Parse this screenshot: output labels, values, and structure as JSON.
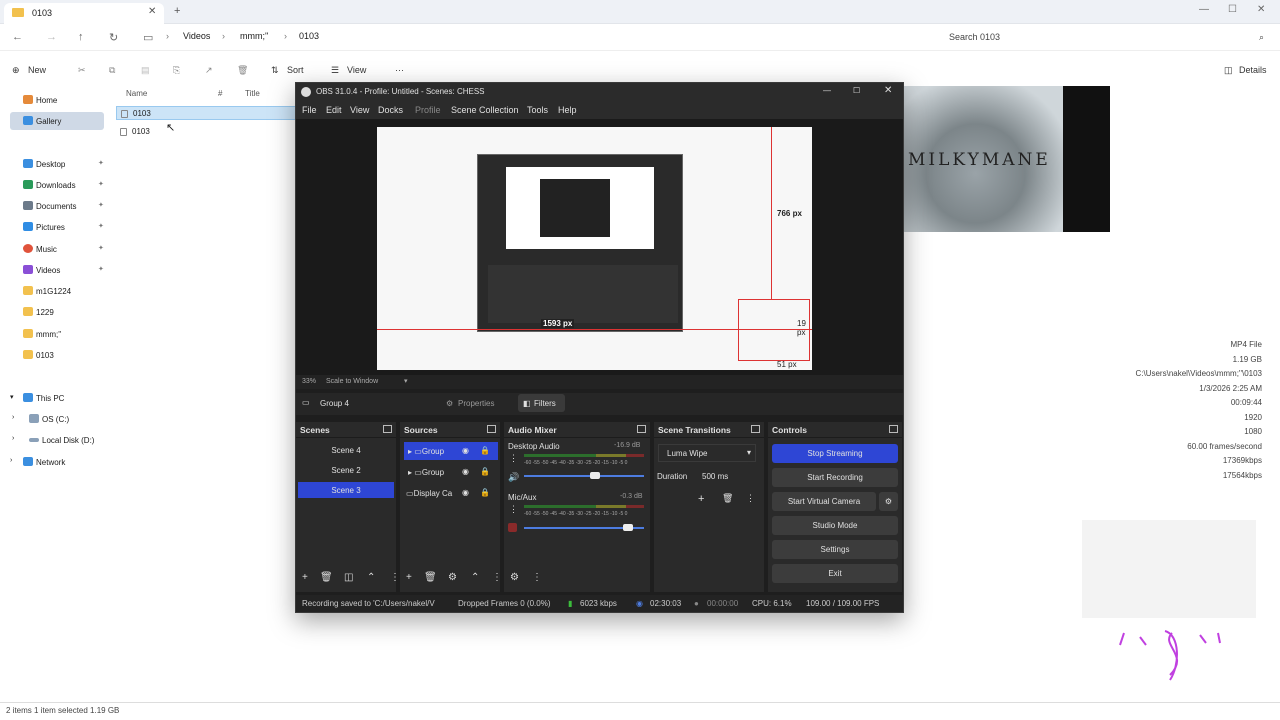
{
  "explorer": {
    "tab_title": "0103",
    "new_tab": "+",
    "breadcrumb": [
      "Videos",
      "mmm;''",
      "0103"
    ],
    "search_placeholder": "Search 0103",
    "toolbar": {
      "new": "New",
      "sort": "Sort",
      "view": "View",
      "more": "···",
      "details": "Details"
    },
    "nav_top": [
      "Home",
      "Gallery"
    ],
    "nav_pinned": [
      "Desktop",
      "Downloads",
      "Documents",
      "Pictures",
      "Music",
      "Videos"
    ],
    "nav_folders": [
      "m1G1224",
      "1229",
      "mmm;''",
      "0103"
    ],
    "nav_tree": [
      "This PC",
      "OS (C:)",
      "Local Disk (D:)",
      "Network"
    ],
    "columns": [
      "Name",
      "#",
      "Title"
    ],
    "files": [
      "0103",
      "0103"
    ],
    "preview_text": "MILKYMANE",
    "properties": [
      "MP4 File",
      "1.19 GB",
      "C:\\Users\\nakel\\Videos\\mmm;''\\0103",
      "1/3/2026 2:25 AM",
      "00:09:44",
      "1920",
      "1080",
      "60.00 frames/second",
      "17369kbps",
      "17564kbps"
    ],
    "status": "2 items   1 item selected  1.19 GB"
  },
  "obs": {
    "title": "OBS 31.0.4 - Profile: Untitled - Scenes: CHESS",
    "menu": [
      "File",
      "Edit",
      "View",
      "Docks",
      "Profile",
      "Scene Collection",
      "Tools",
      "Help"
    ],
    "preview_labels": {
      "w": "1593 px",
      "h": "766 px",
      "a": "19 px",
      "b": "51 px"
    },
    "zoom": "33%",
    "scale_label": "Scale to Window",
    "selected_source": "Group 4",
    "properties_btn": "Properties",
    "filters_btn": "Filters",
    "docks": {
      "scenes": "Scenes",
      "sources": "Sources",
      "audio": "Audio Mixer",
      "transitions": "Scene Transitions",
      "controls": "Controls"
    },
    "scenes": [
      "Scene 4",
      "Scene 2",
      "Scene 3"
    ],
    "sources": [
      "Group",
      "Group",
      "Display Ca"
    ],
    "audio": [
      {
        "name": "Desktop Audio",
        "db": "-16.9 dB",
        "level": 0.6
      },
      {
        "name": "Mic/Aux",
        "db": "-0.3 dB",
        "level": 0.9
      }
    ],
    "meter_scale": "-60 -55 -50 -45 -40 -35 -30 -25 -20 -15 -10 -5 0",
    "transition": "Luma Wipe",
    "duration_label": "Duration",
    "duration": "500 ms",
    "controls": [
      "Stop Streaming",
      "Start Recording",
      "Start Virtual Camera",
      "Studio Mode",
      "Settings",
      "Exit"
    ],
    "status": {
      "saved": "Recording saved to 'C:/Users/nakel/V",
      "dropped": "Dropped Frames 0 (0.0%)",
      "kbps": "6023 kbps",
      "stream_time": "02:30:03",
      "rec_time": "00:00:00",
      "cpu": "CPU: 6.1%",
      "fps": "109.00 / 109.00 FPS"
    }
  }
}
